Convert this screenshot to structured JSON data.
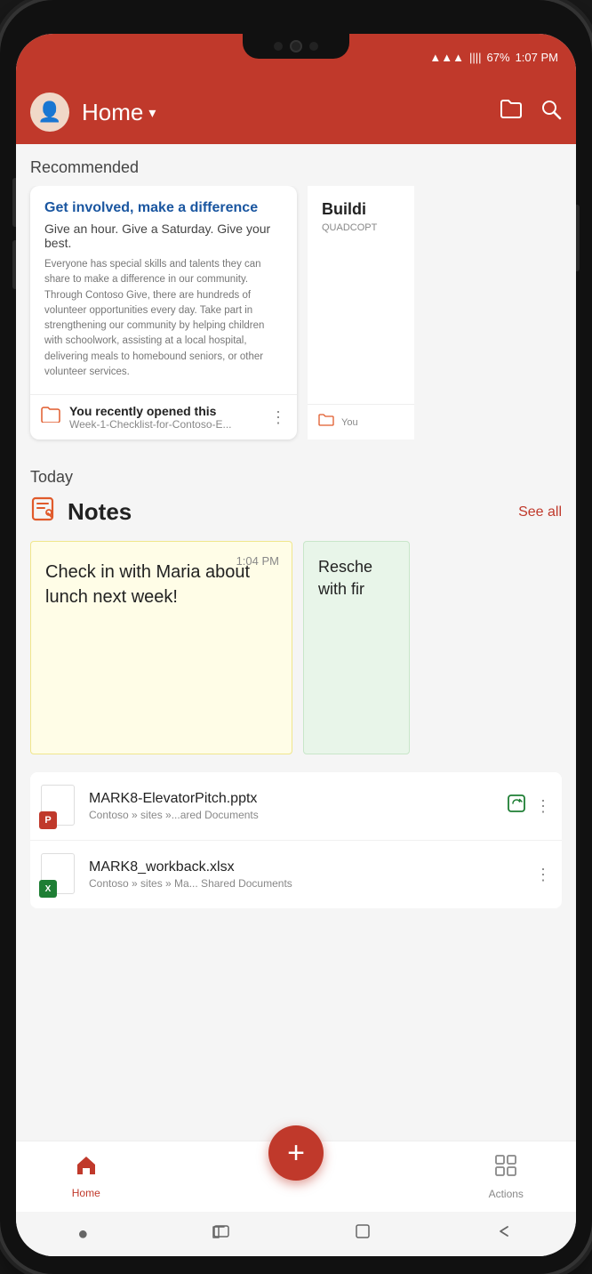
{
  "phone": {
    "status_bar": {
      "wifi": "📶",
      "signal": "📶",
      "battery_percent": "67%",
      "time": "1:07 PM"
    }
  },
  "header": {
    "title": "Home",
    "chevron": "▾",
    "folder_icon": "folder",
    "search_icon": "search"
  },
  "recommended": {
    "section_label": "Recommended",
    "card1": {
      "title": "Get involved, make a difference",
      "subtitle": "Give an hour. Give a Saturday. Give your best.",
      "body": "Everyone has special skills and talents they can share to make a difference in our community. Through Contoso Give, there are hundreds of volunteer opportunities every day. Take part in strengthening our community by helping children with schoolwork, assisting at a local hospital, delivering meals to homebound seniors, or other volunteer services.",
      "footer_label": "You recently opened this",
      "file_name": "Week-1-Checklist-for-Contoso-E..."
    },
    "card2": {
      "title": "Buildi",
      "subtitle": "QUADCOPT"
    }
  },
  "today": {
    "section_label": "Today",
    "notes": {
      "title": "Notes",
      "see_all": "See all",
      "note1": {
        "time": "1:04 PM",
        "text": "Check in with Maria about lunch next week!"
      },
      "note2": {
        "text": "Resche with fir"
      }
    },
    "files": [
      {
        "name": "MARK8-ElevatorPitch.pptx",
        "path": "Contoso » sites »...ared Documents",
        "type": "pptx"
      },
      {
        "name": "MARK8_workback.xlsx",
        "path": "Contoso » sites » Ma... Shared Documents",
        "type": "xlsx"
      }
    ]
  },
  "bottom_nav": {
    "home_label": "Home",
    "add_label": "+",
    "actions_label": "Actions"
  },
  "system_nav": {
    "dot": "●",
    "recent": "⬛",
    "back": "←",
    "nav_icon": "⬒"
  }
}
